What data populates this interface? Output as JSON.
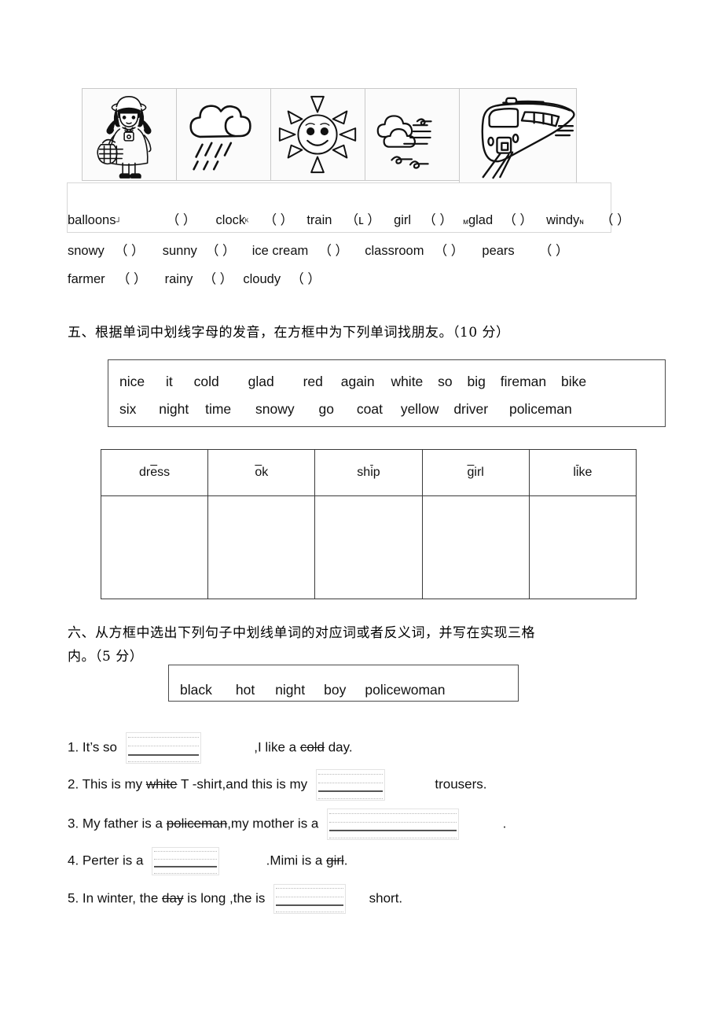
{
  "pictures": [
    {
      "name": "girl-illustration",
      "alt": "girl with basket"
    },
    {
      "name": "rain-cloud-illustration",
      "alt": "rainy cloud"
    },
    {
      "name": "sun-illustration",
      "alt": "smiling sun"
    },
    {
      "name": "wind-illustration",
      "alt": "windy clouds"
    },
    {
      "name": "train-illustration",
      "alt": "train"
    }
  ],
  "word_list": {
    "rows": [
      [
        {
          "word": "balloons",
          "mark": "┘",
          "paren": "（    ）"
        },
        {
          "word": "clock",
          "mark": "ᴷ",
          "paren": "（    ）"
        },
        {
          "word": "train",
          "pre": "",
          "paren": "（ʟ    ）"
        },
        {
          "word": "girl",
          "paren": "（    ）"
        },
        {
          "word": "glad",
          "pre": "ᴍ",
          "paren": "（    ）"
        },
        {
          "word": "windy",
          "mark": "ɴ",
          "paren": "（    ）"
        }
      ],
      [
        {
          "word": "snowy",
          "paren": "（    ）"
        },
        {
          "word": "sunny",
          "paren": "（    ）"
        },
        {
          "word": "ice cream",
          "paren": "（    ）"
        },
        {
          "word": "classroom",
          "paren": "（    ）"
        },
        {
          "word": "pears",
          "paren": "（    ）"
        }
      ],
      [
        {
          "word": "farmer",
          "paren": "（    ）"
        },
        {
          "word": "rainy",
          "paren": "（    ）"
        },
        {
          "word": "cloudy",
          "paren": "（    ）"
        }
      ]
    ]
  },
  "section5": {
    "heading": "五、根据单词中划线字母的发音，在方框中为下列单词找朋友。（10 分）",
    "word_bank": {
      "row1": [
        "nice",
        "it",
        "cold",
        "glad",
        "red",
        "again",
        "white",
        "so",
        "big",
        "fireman",
        "bike"
      ],
      "row2": [
        "six",
        "night",
        "time",
        "snowy",
        "go",
        "coat",
        "yellow",
        "driver",
        "policeman"
      ]
    },
    "table": {
      "headers": [
        {
          "before": "dr",
          "marked": "e",
          "after": "ss",
          "full": "dress"
        },
        {
          "before": "",
          "marked": "o",
          "after": "k",
          "full": "ok"
        },
        {
          "before": "sh",
          "marked": "i",
          "after": "p",
          "full": "ship"
        },
        {
          "before": "",
          "marked": "g",
          "after": "irl",
          "full": "girl"
        },
        {
          "before": "l",
          "marked": "i",
          "after": "ke",
          "full": "like"
        }
      ],
      "answer_row": [
        "",
        "",
        "",
        "",
        ""
      ]
    }
  },
  "section6": {
    "heading_line1": "六、从方框中选出下列句子中划线单词的对应词或者反义词，并写在实现三格",
    "heading_line2": "内。（5 分）",
    "word_bank": [
      "black",
      "hot",
      "night",
      "boy",
      "policewoman"
    ],
    "sentences": [
      {
        "number": "1.",
        "part1": "It’s   so",
        "part2": ",I like a ",
        "underlined": "cold",
        "part3": " day."
      },
      {
        "number": "2.",
        "part1": "This is my ",
        "underlined1": "white",
        "part1b": " T -shirt,and this is my",
        "part2": "",
        "part3": "trousers."
      },
      {
        "number": "3.",
        "part1": "My father is a ",
        "underlined": "policeman",
        "part1b": ",my mother is a",
        "part3": "."
      },
      {
        "number": "4.",
        "part1": "Perter  is  a",
        "part2": ".Mimi is a ",
        "underlined": "girl",
        "part3": "."
      },
      {
        "number": "5.",
        "part1": "In  winter,  the ",
        "underlined": "day",
        "part1b": " is  long  ,the  is",
        "part3": "short."
      }
    ]
  },
  "colors": {
    "text": "#111111",
    "border_dark": "#3a3a3a",
    "border_light": "#d7d7d7",
    "rule_bold": "#555555",
    "rule_dotted": "#b9b9b9"
  }
}
